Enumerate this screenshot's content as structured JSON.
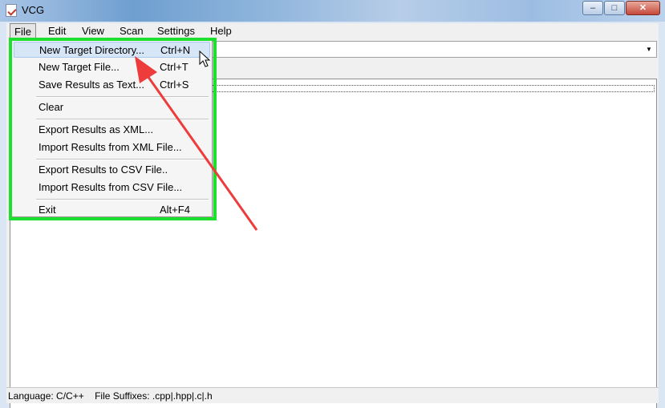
{
  "window": {
    "title": "VCG",
    "controls": {
      "minimize": "–",
      "maximize": "□",
      "close": "✕"
    }
  },
  "menubar": {
    "items": [
      "File",
      "Edit",
      "View",
      "Scan",
      "Settings",
      "Help"
    ],
    "active": "File"
  },
  "file_menu": {
    "items": [
      {
        "label": "New Target Directory...",
        "shortcut": "Ctrl+N",
        "highlighted": true
      },
      {
        "label": "New Target File...",
        "shortcut": "Ctrl+T"
      },
      {
        "label": "Save Results as Text...",
        "shortcut": "Ctrl+S"
      },
      {
        "label": "Clear",
        "shortcut": ""
      },
      {
        "label": "Export Results as XML...",
        "shortcut": ""
      },
      {
        "label": "Import Results from XML File...",
        "shortcut": ""
      },
      {
        "label": "Export Results to CSV File..",
        "shortcut": ""
      },
      {
        "label": "Import Results from CSV File...",
        "shortcut": ""
      },
      {
        "label": "Exit",
        "shortcut": "Alt+F4"
      }
    ]
  },
  "statusbar": {
    "language": "Language: C/C++",
    "suffixes": "File Suffixes: .cpp|.hpp|.c|.h"
  },
  "annotation": {
    "box_color": "#1ddf2e",
    "arrow_color": "#ee3b3b",
    "icon": "mouse-cursor-icon"
  }
}
